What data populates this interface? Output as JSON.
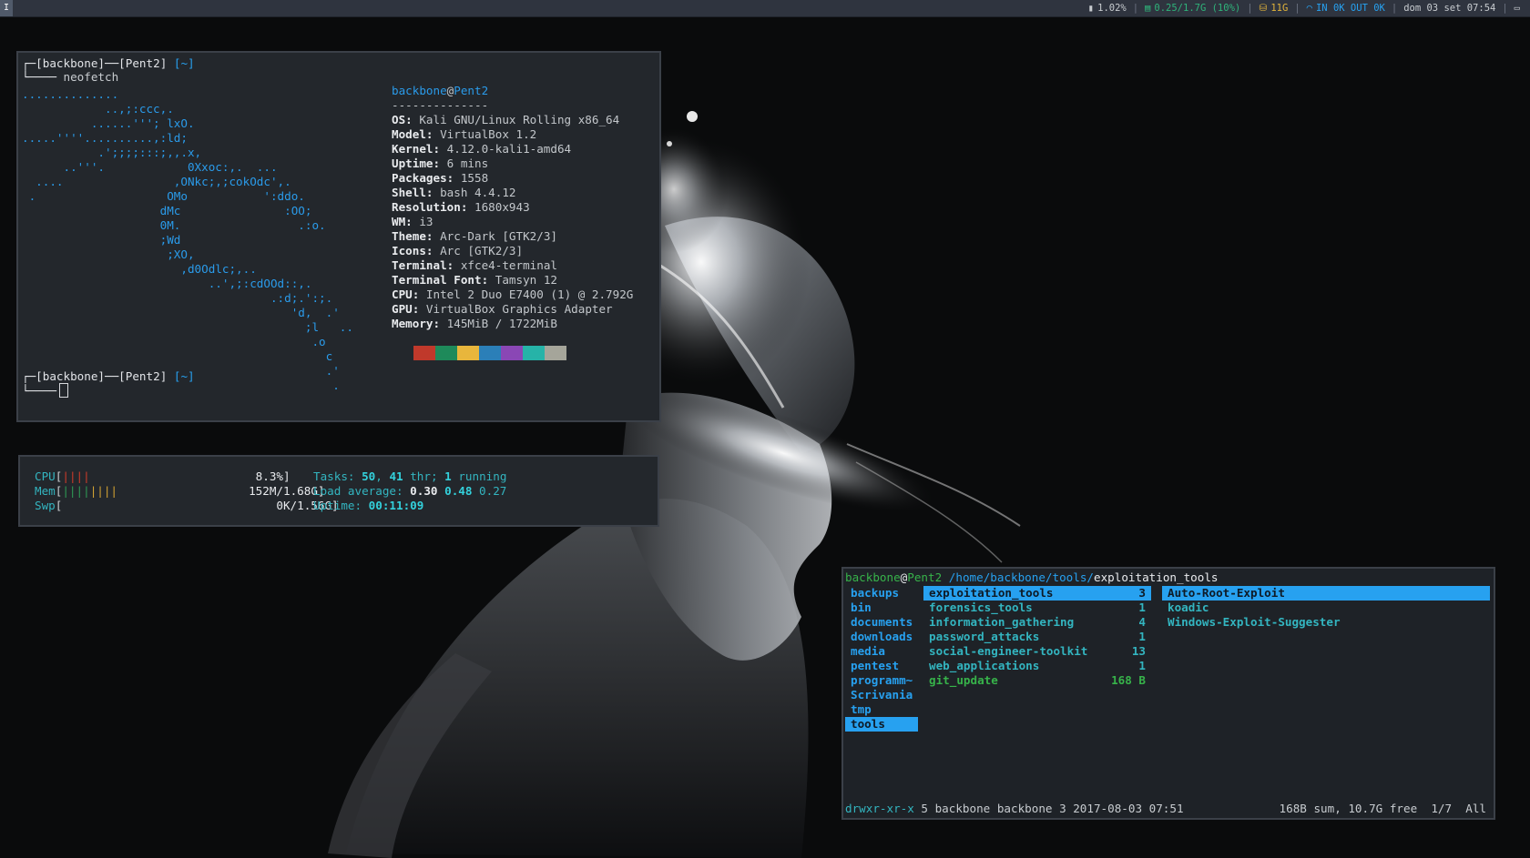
{
  "topbar": {
    "workspace": "I",
    "cpu": "1.02%",
    "memory": "0.25/1.7G (10%)",
    "disk": "11G",
    "net_in": "IN 0K",
    "net_out": "OUT 0K",
    "datetime": "dom 03 set 07:54",
    "colors": {
      "memory": "#2fb37a",
      "disk": "#e0b23a",
      "net": "#27a1f0"
    }
  },
  "neofetch": {
    "prompt1": {
      "user": "backbone",
      "host": "Pent2",
      "dir": "[~]"
    },
    "command": "neofetch",
    "logo_lines": [
      "..............",
      "            ..,;:ccc,.",
      "          ......'''; lxO.",
      ".....''''..........,:ld;",
      "           .';;;;:::;,,.x,",
      "      ..'''.            0Xxoc:,.  ...",
      "  ....                ,ONkc;,;cokOdc',.",
      " .                   OMo           ':ddo.",
      "                    dMc               :OO;",
      "                    0M.                 .:o.",
      "                    ;Wd",
      "                     ;XO,",
      "                       ,d0Odlc;,..",
      "                           ..',;:cdOOd::,.",
      "                                    .:d;.':;.",
      "                                       'd,  .'",
      "                                         ;l   ..",
      "                                          .o",
      "                                            c",
      "                                            .'",
      "                                             ."
    ],
    "user": "backbone",
    "host": "Pent2",
    "separator": "--------------",
    "info": [
      {
        "key": "OS",
        "value": "Kali GNU/Linux Rolling x86_64"
      },
      {
        "key": "Model",
        "value": "VirtualBox 1.2"
      },
      {
        "key": "Kernel",
        "value": "4.12.0-kali1-amd64"
      },
      {
        "key": "Uptime",
        "value": "6 mins"
      },
      {
        "key": "Packages",
        "value": "1558"
      },
      {
        "key": "Shell",
        "value": "bash 4.4.12"
      },
      {
        "key": "Resolution",
        "value": "1680x943"
      },
      {
        "key": "WM",
        "value": "i3"
      },
      {
        "key": "Theme",
        "value": "Arc-Dark [GTK2/3]"
      },
      {
        "key": "Icons",
        "value": "Arc [GTK2/3]"
      },
      {
        "key": "Terminal",
        "value": "xfce4-terminal"
      },
      {
        "key": "Terminal Font",
        "value": "Tamsyn 12"
      },
      {
        "key": "CPU",
        "value": "Intel 2 Duo E7400 (1) @ 2.792G"
      },
      {
        "key": "GPU",
        "value": "VirtualBox Graphics Adapter"
      },
      {
        "key": "Memory",
        "value": "145MiB / 1722MiB"
      }
    ],
    "swatches": [
      "#23272c",
      "#c0392b",
      "#1e8a5a",
      "#e8b63c",
      "#2b7fb8",
      "#8a47b5",
      "#26b3a8",
      "#a5a59a"
    ],
    "prompt2": {
      "user": "backbone",
      "host": "Pent2",
      "dir": "[~]"
    }
  },
  "htop": {
    "cpu_label": "CPU",
    "cpu_value": "8.3%]",
    "mem_label": "Mem",
    "mem_value": "152M/1.68G]",
    "swp_label": "Swp",
    "swp_value": "0K/1.56G]",
    "tasks_label": "Tasks:",
    "tasks": "50",
    "threads": "41",
    "thr_label": "thr;",
    "running": "1",
    "running_label": "running",
    "load_label": "Load average:",
    "load1": "0.30",
    "load5": "0.48",
    "load15": "0.27",
    "uptime_label": "Uptime:",
    "uptime": "00:11:09"
  },
  "ranger": {
    "user": "backbone",
    "host": "Pent2",
    "path": "/home/backbone/tools/",
    "current": "exploitation_tools",
    "parent_dirs": [
      "backups",
      "bin",
      "documents",
      "downloads",
      "media",
      "pentest",
      "programm~",
      "Scrivania",
      "tmp",
      "tools"
    ],
    "entries": [
      {
        "name": "exploitation_tools",
        "count": "3"
      },
      {
        "name": "forensics_tools",
        "count": "1"
      },
      {
        "name": "information_gathering",
        "count": "4"
      },
      {
        "name": "password_attacks",
        "count": "1"
      },
      {
        "name": "social-engineer-toolkit",
        "count": "13"
      },
      {
        "name": "web_applications",
        "count": "1"
      },
      {
        "name": "git_update",
        "count": "168 B"
      }
    ],
    "preview": [
      "Auto-Root-Exploit",
      "koadic",
      "Windows-Exploit-Suggester"
    ],
    "status_perm": "drwxr-xr-x",
    "status_info": "5 backbone backbone 3 2017-08-03 07:51",
    "status_right": "168B sum, 10.7G free  1/7  All"
  }
}
